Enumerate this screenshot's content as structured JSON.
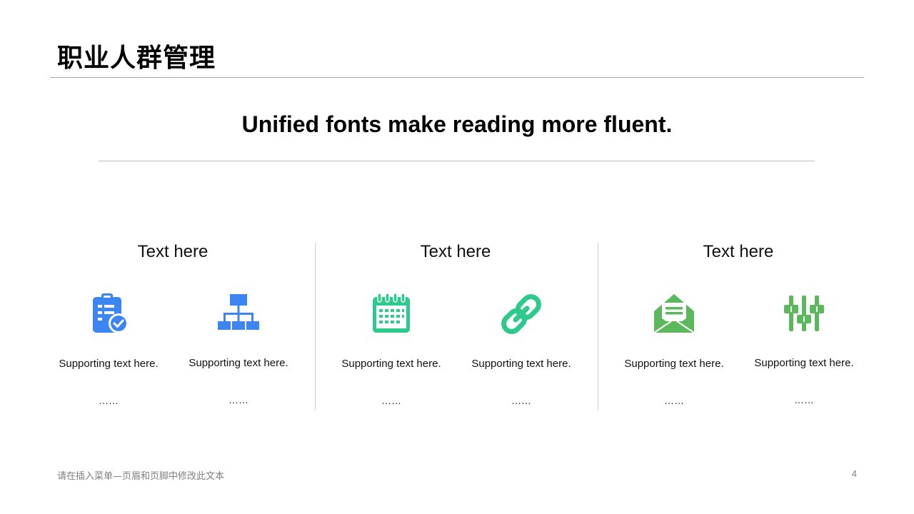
{
  "slide": {
    "title": "职业人群管理",
    "subtitle": "Unified fonts make reading more fluent."
  },
  "colors": {
    "blue": "#3d85f2",
    "teal": "#2ec98c",
    "green": "#5cb85c"
  },
  "columns": [
    {
      "heading": "Text here",
      "items": [
        {
          "icon": "clipboard-check-icon",
          "support": "Supporting  text here.",
          "dots": "……"
        },
        {
          "icon": "sitemap-icon",
          "support": "Supporting  text here.",
          "dots": "……"
        }
      ]
    },
    {
      "heading": "Text here",
      "items": [
        {
          "icon": "calendar-icon",
          "support": "Supporting  text here.",
          "dots": "……"
        },
        {
          "icon": "link-icon",
          "support": "Supporting  text here.",
          "dots": "……"
        }
      ]
    },
    {
      "heading": "Text here",
      "items": [
        {
          "icon": "open-envelope-icon",
          "support": "Supporting  text here.",
          "dots": "……"
        },
        {
          "icon": "sliders-icon",
          "support": "Supporting  text here.",
          "dots": "……"
        }
      ]
    }
  ],
  "footer": {
    "text": "请在插入菜单—页眉和页脚中修改此文本",
    "page_number": "4"
  }
}
